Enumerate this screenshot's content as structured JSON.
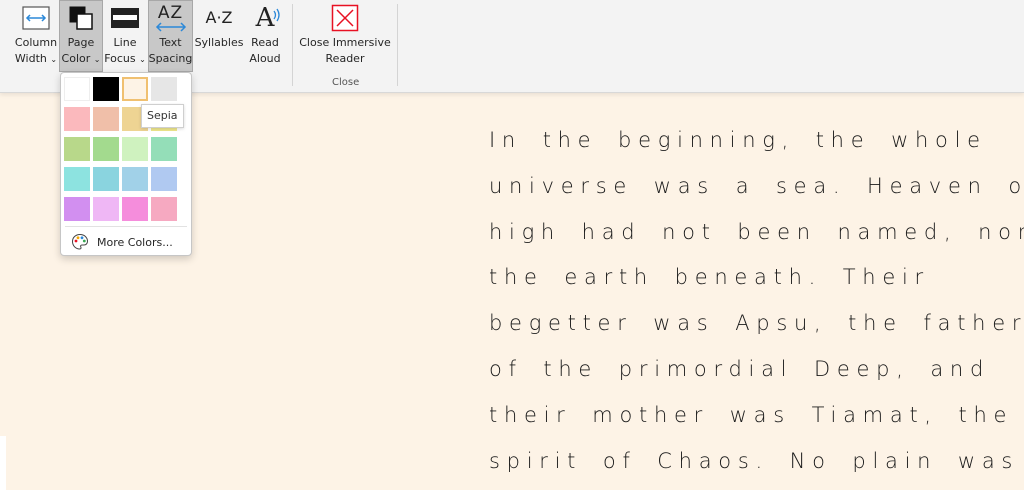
{
  "ribbon": {
    "column_width": {
      "line1": "Column",
      "line2": "Width"
    },
    "page_color": {
      "line1": "Page",
      "line2": "Color"
    },
    "line_focus": {
      "line1": "Line",
      "line2": "Focus"
    },
    "text_spacing": {
      "line1": "Text",
      "line2": "Spacing",
      "icon_text": "AZ"
    },
    "syllables": {
      "label": "Syllables",
      "icon_text": "A·Z"
    },
    "read_aloud": {
      "line1": "Read",
      "line2": "Aloud",
      "icon_text": "A"
    },
    "close_reader": {
      "line1": "Close Immersive",
      "line2": "Reader"
    },
    "group_close_label": "Close",
    "chevron": "⌄"
  },
  "dropdown": {
    "swatches": [
      {
        "name": "white",
        "color": "#ffffff"
      },
      {
        "name": "black",
        "color": "#000000"
      },
      {
        "name": "sepia",
        "color": "#fdf3e6",
        "selected": true
      },
      {
        "name": "light-gray",
        "color": "#e6e6e6"
      },
      {
        "name": "pink",
        "color": "#fbb9bd"
      },
      {
        "name": "peach",
        "color": "#f0bfa9"
      },
      {
        "name": "tan",
        "color": "#eed493"
      },
      {
        "name": "yellow",
        "color": "#eee68c"
      },
      {
        "name": "olive-green",
        "color": "#b8d88a"
      },
      {
        "name": "green",
        "color": "#a3da8e"
      },
      {
        "name": "light-green",
        "color": "#cff2bf"
      },
      {
        "name": "mint",
        "color": "#94deb8"
      },
      {
        "name": "aqua",
        "color": "#8de3e0"
      },
      {
        "name": "teal",
        "color": "#8ad4df"
      },
      {
        "name": "sky-blue",
        "color": "#a1d1e8"
      },
      {
        "name": "periwinkle",
        "color": "#b0c9f1"
      },
      {
        "name": "purple",
        "color": "#d28ff0"
      },
      {
        "name": "lavender",
        "color": "#efb7f5"
      },
      {
        "name": "magenta",
        "color": "#f58ddc"
      },
      {
        "name": "rose",
        "color": "#f6a9c1"
      }
    ],
    "more_colors": "More Colors...",
    "tooltip": "Sepia"
  },
  "reader": {
    "lines": [
      "In the beginning, the whole",
      "universe was a sea. Heaven on",
      "high had not been named, nor",
      "the earth beneath. Their",
      "begetter was Apsu, the father",
      "of the primordial Deep, and",
      "their mother was Tiamat, the",
      "spirit of Chaos. No plain was"
    ]
  },
  "colors": {
    "page_background": "#fdf3e6",
    "ribbon_background": "#f3f3f3",
    "accent_blue": "#2b88d8",
    "close_red": "#e81123"
  }
}
